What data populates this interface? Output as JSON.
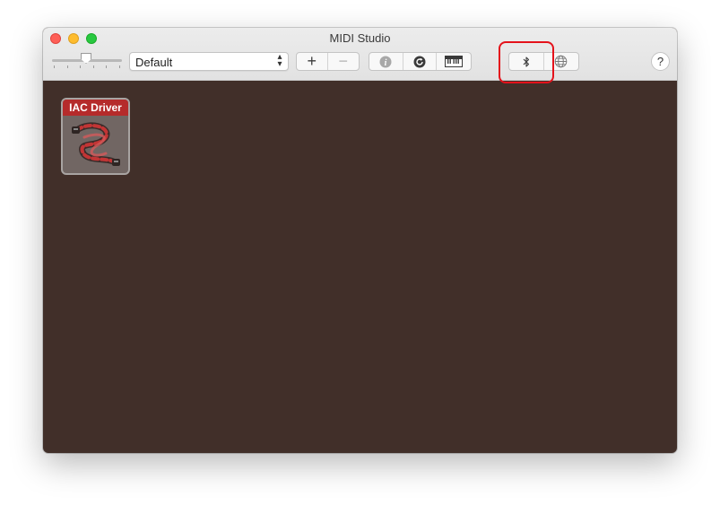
{
  "window": {
    "title": "MIDI Studio"
  },
  "toolbar": {
    "configuration": {
      "selected": "Default"
    },
    "add_symbol": "+",
    "remove_symbol": "−",
    "help_symbol": "?",
    "icons": [
      "info-icon",
      "rescan-icon",
      "keyboard-icon",
      "bluetooth-icon",
      "network-icon"
    ]
  },
  "devices": [
    {
      "name": "IAC Driver"
    }
  ],
  "colors": {
    "canvas": "#412f29",
    "device_header": "#b52b2b",
    "highlight": "#e4121b"
  }
}
